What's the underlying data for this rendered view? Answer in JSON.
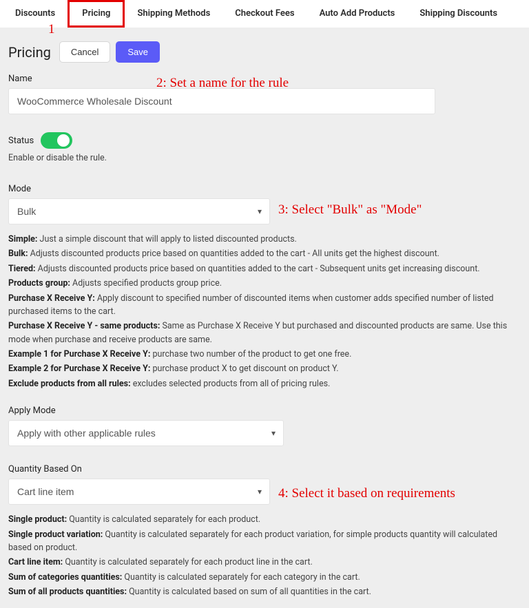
{
  "tabs": {
    "items": [
      "Discounts",
      "Pricing",
      "Shipping Methods",
      "Checkout Fees",
      "Auto Add Products",
      "Shipping Discounts"
    ],
    "active_index": 1
  },
  "annotations": {
    "n1": "1",
    "n2": "2: Set a name for the rule",
    "n3": "3: Select \"Bulk\" as \"Mode\"",
    "n4": "4: Select it based on requirements"
  },
  "page": {
    "title": "Pricing",
    "cancel": "Cancel",
    "save": "Save"
  },
  "name": {
    "label": "Name",
    "value": "WooCommerce Wholesale Discount"
  },
  "status": {
    "label": "Status",
    "helper": "Enable or disable the rule.",
    "on": true
  },
  "mode": {
    "label": "Mode",
    "value": "Bulk",
    "desc": {
      "simple": {
        "label": "Simple:",
        "text": " Just a simple discount that will apply to listed discounted products."
      },
      "bulk": {
        "label": "Bulk:",
        "text": " Adjusts discounted products price based on quantities added to the cart - All units get the highest discount."
      },
      "tiered": {
        "label": "Tiered:",
        "text": " Adjusts discounted products price based on quantities added to the cart - Subsequent units get increasing discount."
      },
      "pgroup": {
        "label": "Products group:",
        "text": " Adjusts specified products group price."
      },
      "pxry": {
        "label": "Purchase X Receive Y:",
        "text": " Apply discount to specified number of discounted items when customer adds specified number of listed purchased items to the cart."
      },
      "pxry_same": {
        "label": "Purchase X Receive Y - same products:",
        "text": " Same as Purchase X Receive Y but purchased and discounted products are same. Use this mode when purchase and receive products are same."
      },
      "ex1": {
        "label": "Example 1 for Purchase X Receive Y:",
        "text": " purchase two number of the product to get one free."
      },
      "ex2": {
        "label": "Example 2 for Purchase X Receive Y:",
        "text": " purchase product X to get discount on product Y."
      },
      "exclude": {
        "label": "Exclude products from all rules:",
        "text": " excludes selected products from all of pricing rules."
      }
    }
  },
  "apply_mode": {
    "label": "Apply Mode",
    "value": "Apply with other applicable rules"
  },
  "qty": {
    "label": "Quantity Based On",
    "value": "Cart line item",
    "desc": {
      "single": {
        "label": "Single product:",
        "text": " Quantity is calculated separately for each product."
      },
      "variation": {
        "label": "Single product variation:",
        "text": " Quantity is calculated separately for each product variation, for simple products quantity will calculated based on product."
      },
      "cartline": {
        "label": "Cart line item:",
        "text": " Quantity is calculated separately for each product line in the cart."
      },
      "sumcat": {
        "label": "Sum of categories quantities:",
        "text": " Quantity is calculated separately for each category in the cart."
      },
      "sumall": {
        "label": "Sum of all products quantities:",
        "text": " Quantity is calculated based on sum of all quantities in the cart."
      }
    }
  }
}
